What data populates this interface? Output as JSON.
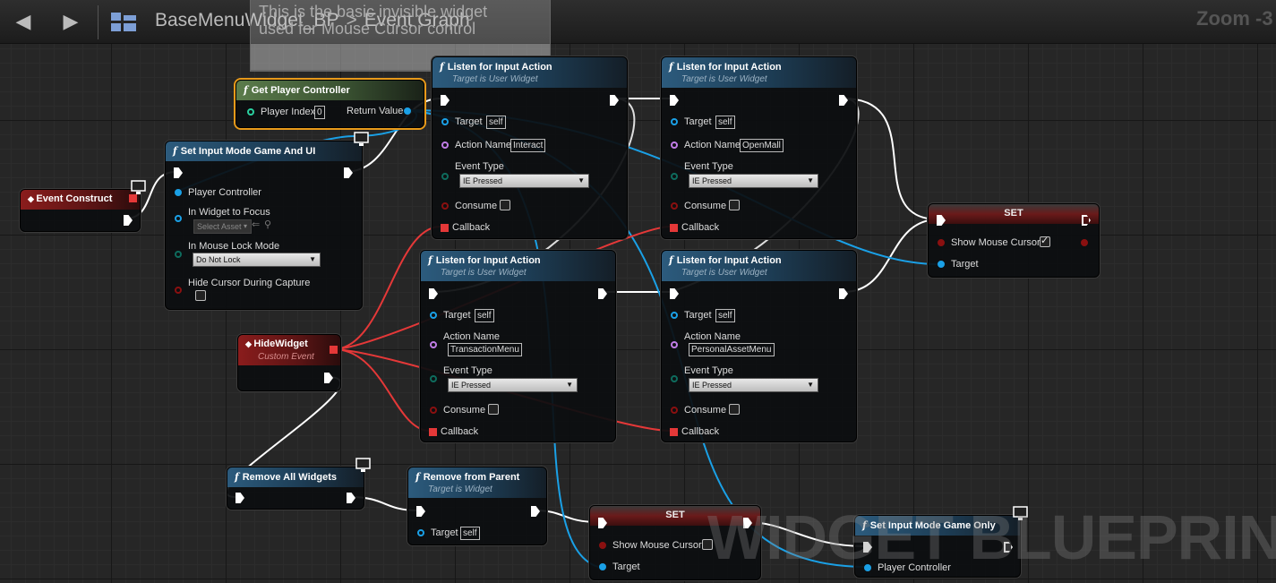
{
  "toolbar": {
    "back_icon": "arrow-left-icon",
    "forward_icon": "arrow-right-icon",
    "breadcrumb_icon": "blueprint-grid-icon",
    "blueprint_name": "BaseMenuWidget_BP",
    "separator": ">",
    "graph_name": "Event Graph",
    "zoom": "Zoom -3"
  },
  "comment": {
    "line1": "This is the basic invisible widget",
    "line2": "used for Mouse Cursor control"
  },
  "nodes": {
    "event_construct": {
      "title": "Event Construct"
    },
    "get_player_controller": {
      "title": "Get Player Controller",
      "player_index_label": "Player Index",
      "player_index_value": "0",
      "return_label": "Return Value"
    },
    "set_input_mode_game_ui": {
      "title": "Set Input Mode Game And UI",
      "player_controller": "Player Controller",
      "in_widget_to_focus": "In Widget to Focus",
      "select_asset": "Select Asset",
      "in_mouse_lock_mode": "In Mouse Lock Mode",
      "mouse_lock_value": "Do Not Lock",
      "hide_cursor": "Hide Cursor During Capture"
    },
    "hide_widget": {
      "title": "HideWidget",
      "subtitle": "Custom Event"
    },
    "listen_interact": {
      "title": "Listen for Input Action",
      "subtitle": "Target is User Widget",
      "target": "Target",
      "target_value": "self",
      "action_name": "Action Name",
      "action_value": "Interact",
      "event_type": "Event Type",
      "event_value": "IE Pressed",
      "consume": "Consume",
      "callback": "Callback"
    },
    "listen_openmall": {
      "title": "Listen for Input Action",
      "subtitle": "Target is User Widget",
      "target": "Target",
      "target_value": "self",
      "action_name": "Action Name",
      "action_value": "OpenMall",
      "event_type": "Event Type",
      "event_value": "IE Pressed",
      "consume": "Consume",
      "callback": "Callback"
    },
    "listen_transaction": {
      "title": "Listen for Input Action",
      "subtitle": "Target is User Widget",
      "target": "Target",
      "target_value": "self",
      "action_name": "Action Name",
      "action_value": "TransactionMenu",
      "event_type": "Event Type",
      "event_value": "IE Pressed",
      "consume": "Consume",
      "callback": "Callback"
    },
    "listen_personal": {
      "title": "Listen for Input Action",
      "subtitle": "Target is User Widget",
      "target": "Target",
      "target_value": "self",
      "action_name": "Action Name",
      "action_value": "PersonalAssetMenu",
      "event_type": "Event Type",
      "event_value": "IE Pressed",
      "consume": "Consume",
      "callback": "Callback"
    },
    "set_show_cursor_1": {
      "title": "SET",
      "show_mouse_cursor": "Show Mouse Cursor",
      "checked": true,
      "target": "Target"
    },
    "remove_all_widgets": {
      "title": "Remove All Widgets"
    },
    "remove_from_parent": {
      "title": "Remove from Parent",
      "subtitle": "Target is Widget",
      "target": "Target",
      "target_value": "self"
    },
    "set_show_cursor_2": {
      "title": "SET",
      "show_mouse_cursor": "Show Mouse Cursor",
      "checked": false,
      "target": "Target"
    },
    "set_input_mode_game_only": {
      "title": "Set Input Mode Game Only",
      "player_controller": "Player Controller"
    }
  },
  "watermark": "WIDGET BLUEPRINT",
  "colors": {
    "exec_wire": "#ffffff",
    "object_wire": "#1aa0e6",
    "delegate_wire": "#e43838",
    "function_header": "#2c5b7d",
    "pure_header": "#5b7c4b",
    "event_header": "#8a1c1c"
  }
}
